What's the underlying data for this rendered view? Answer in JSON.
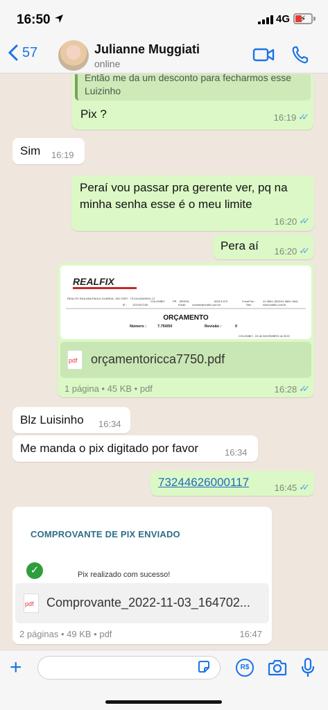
{
  "status_bar": {
    "time": "16:50",
    "network": "4G"
  },
  "header": {
    "back_count": "57",
    "contact_name": "Julianne Muggiati",
    "contact_status": "online"
  },
  "messages": [
    {
      "quote": "Então me da um desconto para fecharmos esse Luizinho",
      "text": "Pix ?",
      "time": "16:19",
      "dir": "out"
    },
    {
      "text": "Sim",
      "time": "16:19",
      "dir": "in"
    },
    {
      "text": "Peraí vou passar pra gerente ver, pq na minha senha esse é o meu limite",
      "time": "16:20",
      "dir": "out"
    },
    {
      "text": "Pera aí",
      "time": "16:20",
      "dir": "out"
    },
    {
      "file_name": "orçamentoricca7750.pdf",
      "file_meta": "1 página • 45 KB • pdf",
      "time": "16:28",
      "dir": "out",
      "preview": {
        "logo": "REALFIX",
        "header_left": "REALFIX\nRUA ANA PAULA GUARDA, 165\nCNPJ : 73.244.626/0001-17",
        "city": "COLOMBO",
        "state": "PR",
        "country": "BRASIL",
        "cep": "83413-570",
        "phone_label": "Fone/Fax :",
        "phones": "41-3661-1802/41-3661-1661",
        "ie_label": "IE :",
        "ie": "1370167105",
        "email_label": "Email :",
        "email": "contato@realfix.com.br",
        "site_label": "Site :",
        "site": "www.realfix.com.br",
        "doc_title": "ORÇAMENTO",
        "numero_label": "Número :",
        "numero": "7.750/50",
        "revisao_label": "Revisão :",
        "revisao": "0",
        "date_line": "COLOMBO , 03 de NOVEMBRO de 2022"
      }
    },
    {
      "text": "Blz Luisinho",
      "time": "16:34",
      "dir": "in"
    },
    {
      "text": "Me manda o pix digitado por favor",
      "time": "16:34",
      "dir": "in"
    },
    {
      "text": "73244626000117",
      "time": "16:45",
      "dir": "out"
    },
    {
      "file_name": "Comprovante_2022-11-03_164702...",
      "file_meta": "2 páginas • 49 KB • pdf",
      "time": "16:47",
      "dir": "in",
      "preview": {
        "title": "COMPROVANTE DE PIX ENVIADO",
        "success": "Pix realizado com sucesso!"
      }
    }
  ],
  "pdf_icon_label": "pdf",
  "input_bar": {
    "placeholder": "",
    "pay_label": "R$"
  },
  "colors": {
    "outgoing_bubble": "#dcf8c6",
    "incoming_bubble": "#ffffff",
    "accent": "#1a73e8",
    "read_ticks": "#4fa3e0"
  }
}
